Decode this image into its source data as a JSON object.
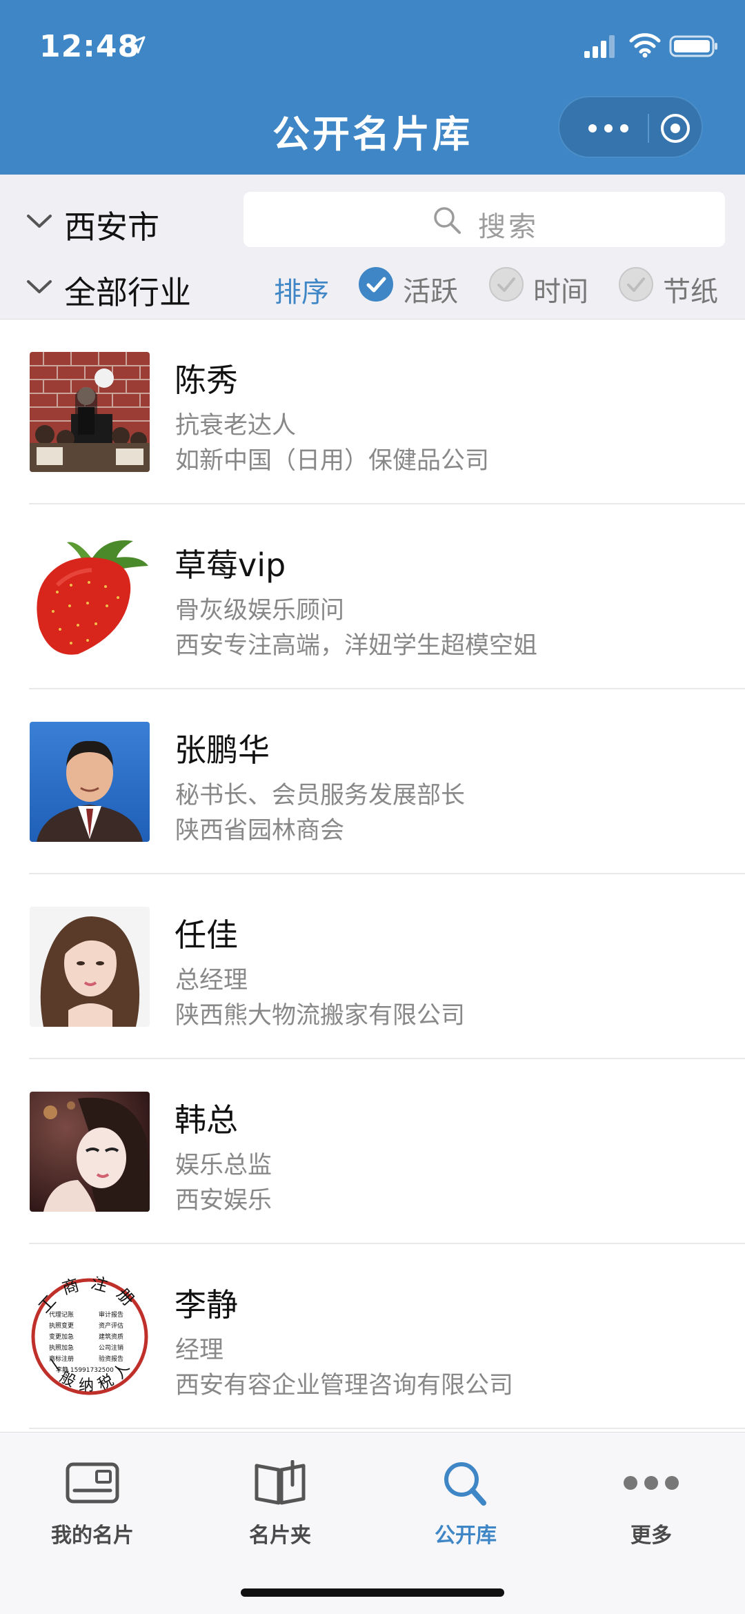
{
  "status_bar": {
    "time": "12:48"
  },
  "header": {
    "title": "公开名片库"
  },
  "filter": {
    "city": "西安市",
    "industry": "全部行业",
    "search_placeholder": "搜索",
    "sort_label": "排序",
    "sort_options": [
      {
        "label": "活跃",
        "selected": true
      },
      {
        "label": "时间",
        "selected": false
      },
      {
        "label": "节纸",
        "selected": false
      }
    ]
  },
  "contacts": [
    {
      "name": "陈秀",
      "role": "抗衰老达人",
      "company": "如新中国（日用）保健品公司"
    },
    {
      "name": "草莓vip",
      "role": "骨灰级娱乐顾问",
      "company": "西安专注高端，洋妞学生超模空姐"
    },
    {
      "name": "张鹏华",
      "role": "秘书长、会员服务发展部长",
      "company": "陕西省园林商会"
    },
    {
      "name": "任佳",
      "role": "总经理",
      "company": "陕西熊大物流搬家有限公司"
    },
    {
      "name": "韩总",
      "role": "娱乐总监",
      "company": "西安娱乐"
    },
    {
      "name": "李静",
      "role": "经理",
      "company": "西安有容企业管理咨询有限公司"
    }
  ],
  "seal": {
    "top_text": "工商注册",
    "bottom_text": "一般纳税人",
    "lines": [
      "代理记账",
      "审计报告",
      "执照变更",
      "资产评估",
      "变更加急",
      "建筑资质",
      "执照加急",
      "公司注销",
      "商标注册",
      "验资报告"
    ],
    "phone": "李静 15991732500"
  },
  "tabbar": {
    "items": [
      {
        "label": "我的名片",
        "icon": "card-icon",
        "active": false
      },
      {
        "label": "名片夹",
        "icon": "book-icon",
        "active": false
      },
      {
        "label": "公开库",
        "icon": "search-icon",
        "active": true
      },
      {
        "label": "更多",
        "icon": "more-icon",
        "active": false
      }
    ]
  },
  "colors": {
    "accent": "#3e86c5",
    "header_bg": "#3e86c5",
    "filter_bg": "#efeff4",
    "secondary_text": "#888888"
  }
}
